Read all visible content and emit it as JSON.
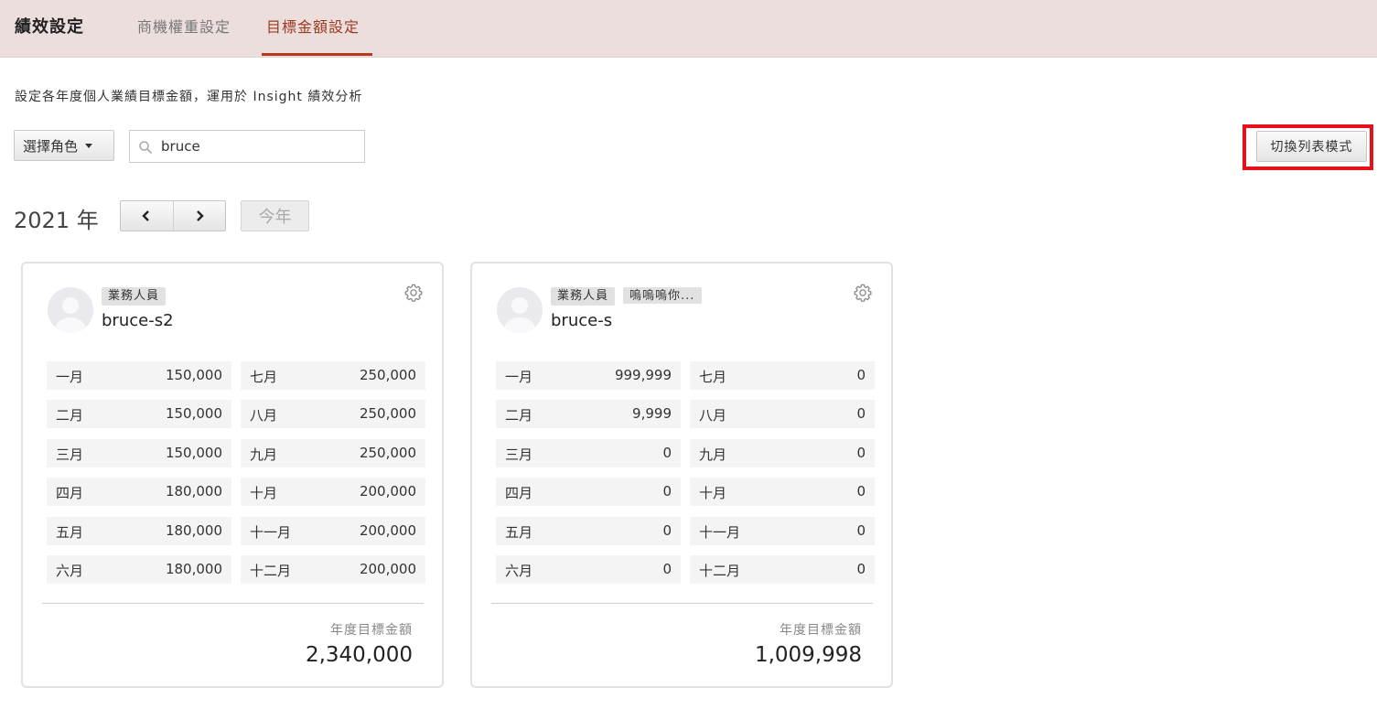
{
  "header": {
    "title": "績效設定",
    "tabs": [
      {
        "label": "商機權重設定",
        "active": false
      },
      {
        "label": "目標金額設定",
        "active": true
      }
    ]
  },
  "description": "設定各年度個人業績目標金額，運用於 Insight 績效分析",
  "toolbar": {
    "role_dropdown_label": "選擇角色",
    "search_value": "bruce",
    "switch_view_label": "切換列表模式"
  },
  "year_nav": {
    "year_label": "2021 年",
    "today_label": "今年"
  },
  "annual_label": "年度目標金額",
  "cards": [
    {
      "name": "bruce-s2",
      "tags": [
        "業務人員"
      ],
      "months": [
        {
          "label": "一月",
          "value": "150,000"
        },
        {
          "label": "二月",
          "value": "150,000"
        },
        {
          "label": "三月",
          "value": "150,000"
        },
        {
          "label": "四月",
          "value": "180,000"
        },
        {
          "label": "五月",
          "value": "180,000"
        },
        {
          "label": "六月",
          "value": "180,000"
        },
        {
          "label": "七月",
          "value": "250,000"
        },
        {
          "label": "八月",
          "value": "250,000"
        },
        {
          "label": "九月",
          "value": "250,000"
        },
        {
          "label": "十月",
          "value": "200,000"
        },
        {
          "label": "十一月",
          "value": "200,000"
        },
        {
          "label": "十二月",
          "value": "200,000"
        }
      ],
      "annual_total": "2,340,000"
    },
    {
      "name": "bruce-s",
      "tags": [
        "業務人員",
        "嗚嗚嗚你..."
      ],
      "months": [
        {
          "label": "一月",
          "value": "999,999"
        },
        {
          "label": "二月",
          "value": "9,999"
        },
        {
          "label": "三月",
          "value": "0"
        },
        {
          "label": "四月",
          "value": "0"
        },
        {
          "label": "五月",
          "value": "0"
        },
        {
          "label": "六月",
          "value": "0"
        },
        {
          "label": "七月",
          "value": "0"
        },
        {
          "label": "八月",
          "value": "0"
        },
        {
          "label": "九月",
          "value": "0"
        },
        {
          "label": "十月",
          "value": "0"
        },
        {
          "label": "十一月",
          "value": "0"
        },
        {
          "label": "十二月",
          "value": "0"
        }
      ],
      "annual_total": "1,009,998"
    }
  ],
  "colors": {
    "header_bg": "#eddede",
    "active_tab": "#9a3a1e",
    "active_underline": "#b23b1a",
    "highlight_box": "#e8101a"
  }
}
